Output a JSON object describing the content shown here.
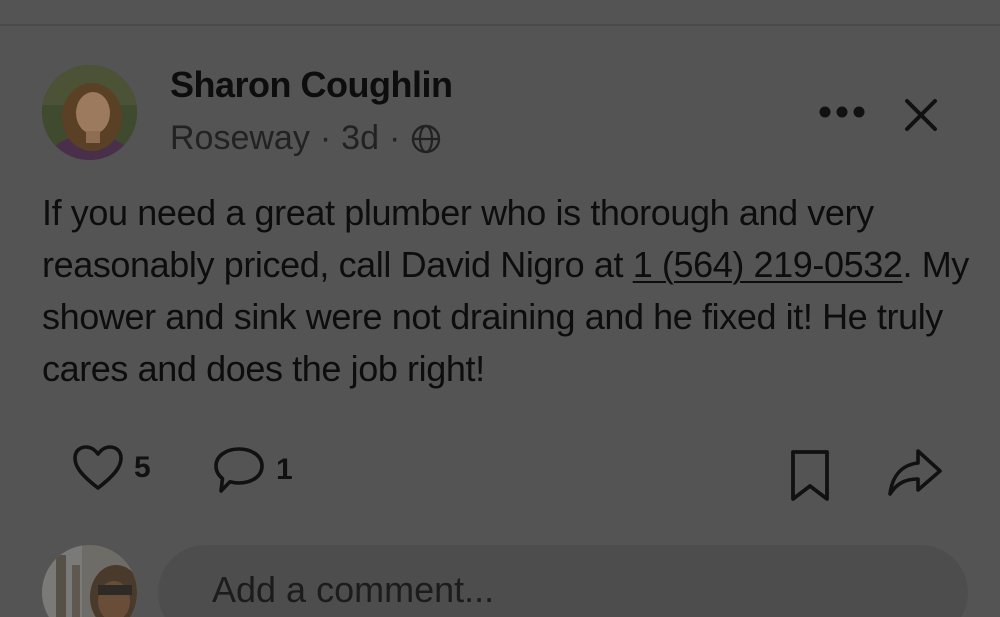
{
  "post": {
    "author_name": "Sharon Coughlin",
    "neighborhood": "Roseway",
    "separator": "·",
    "age": "3d",
    "visibility_icon": "globe-icon",
    "body_before_link": "If you need a great plumber who is thorough and very reasonably priced, call David Nigro at ",
    "phone_link": "1 (564) 219-0532",
    "body_after_link": ". My shower and sink were not draining and he fixed it! He truly cares and does the job right!"
  },
  "header_actions": {
    "more_icon": "more-horizontal-icon",
    "close_icon": "close-icon"
  },
  "actions": {
    "like_count": "5",
    "comment_count": "1",
    "like_icon": "heart-icon",
    "comment_icon": "comment-bubble-icon",
    "save_icon": "bookmark-icon",
    "share_icon": "share-arrow-icon"
  },
  "comment_box": {
    "placeholder": "Add a comment..."
  },
  "colors": {
    "background": "#545454",
    "text": "#0d0d0d",
    "input_background": "#4d4d4d"
  }
}
